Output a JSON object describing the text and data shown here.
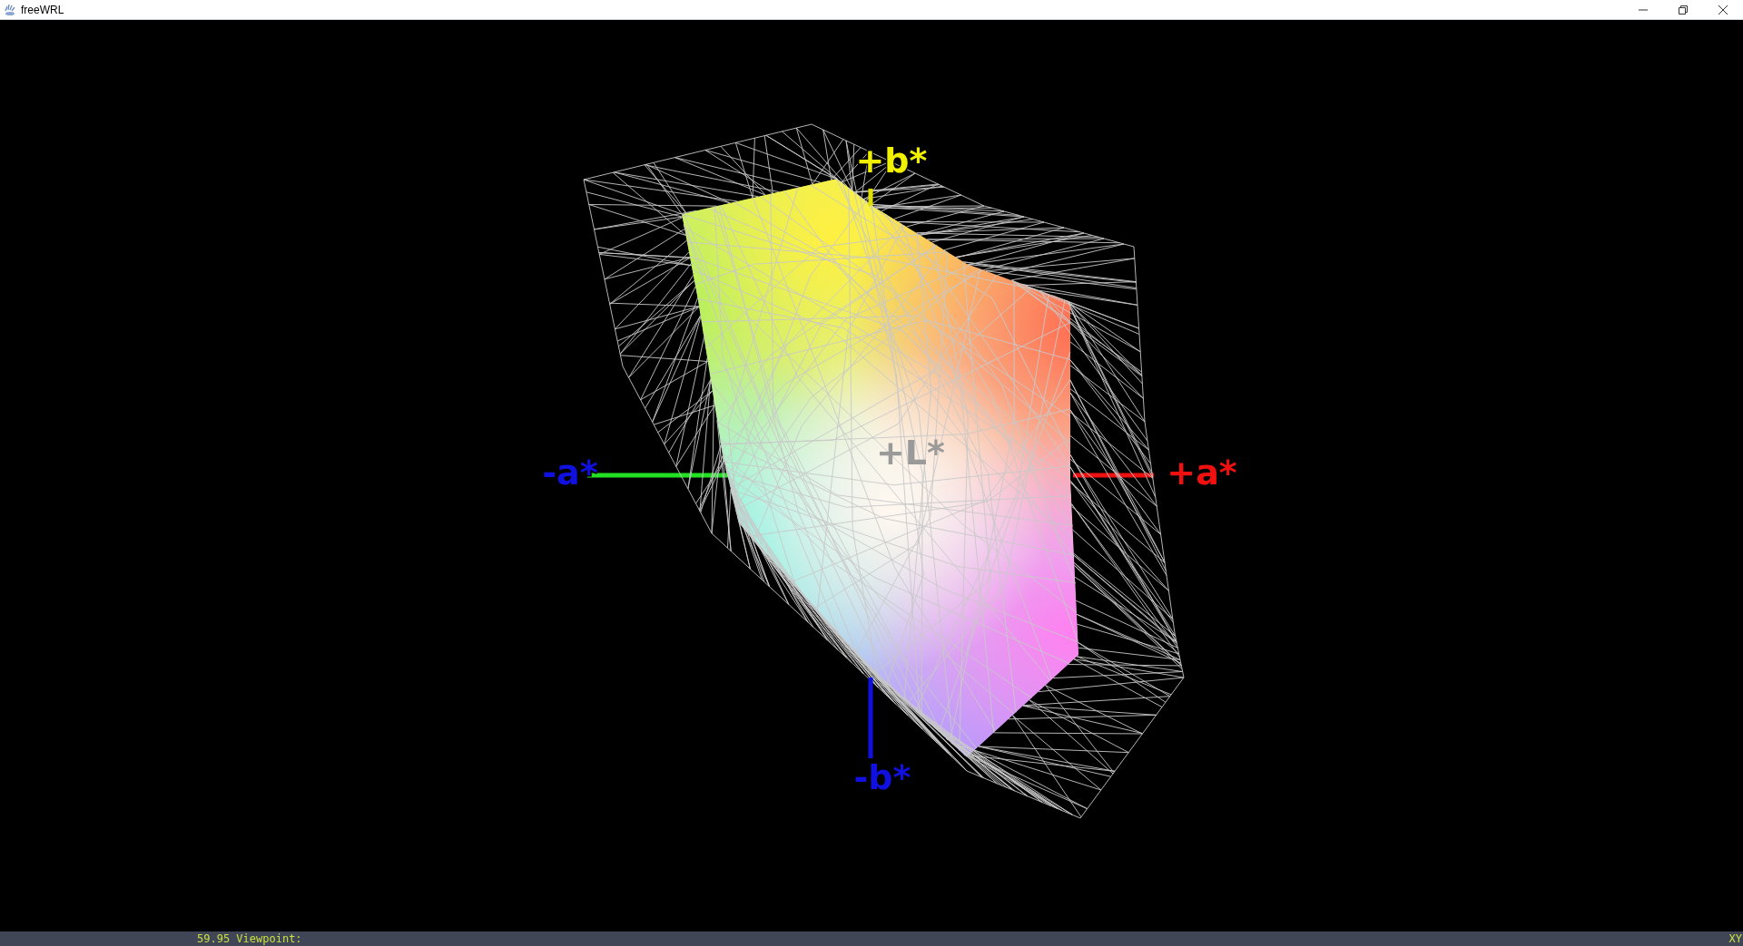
{
  "window": {
    "title": "freeWRL"
  },
  "viewport": {
    "axes": [
      {
        "label": "+b*",
        "color": "#f0f000"
      },
      {
        "label": "+L*",
        "color": "#9a9a9a"
      },
      {
        "label": "-a*",
        "color": "#1010e0"
      },
      {
        "label": "+a*",
        "color": "#f01010"
      },
      {
        "label": "-b*",
        "color": "#1010e0"
      }
    ]
  },
  "status_bar": {
    "left": "59.95 Viewpoint:",
    "right": "XY"
  }
}
